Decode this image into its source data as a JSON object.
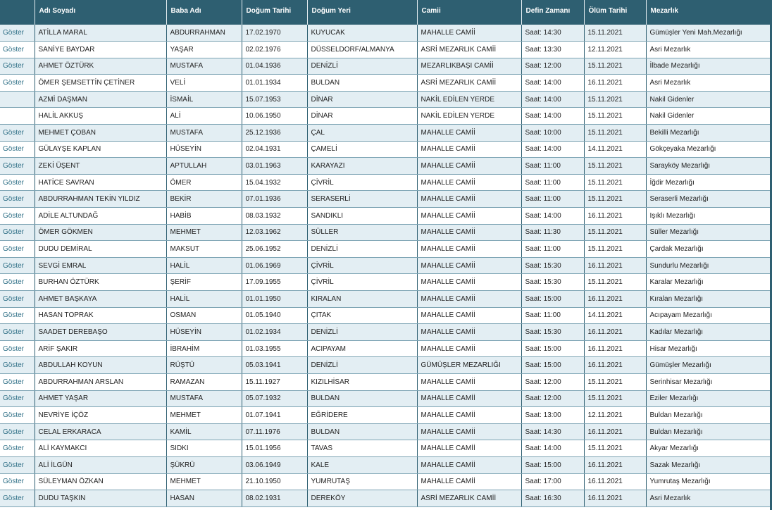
{
  "headers": [
    "",
    "Adı Soyadı",
    "Baba Adı",
    "Doğum Tarihi",
    "Doğum Yeri",
    "Camii",
    "Defin Zamanı",
    "Ölüm Tarihi",
    "Mezarlık"
  ],
  "show_label": "Göster",
  "rows": [
    {
      "show": true,
      "name": "ATİLLA MARAL",
      "father": "ABDURRAHMAN",
      "birth_date": "17.02.1970",
      "birth_place": "KUYUCAK",
      "mosque": "MAHALLE CAMİİ",
      "burial_time": "Saat: 14:30",
      "death_date": "15.11.2021",
      "cemetery": "Gümüşler Yeni Mah.Mezarlığı"
    },
    {
      "show": true,
      "name": "SANİYE BAYDAR",
      "father": "YAŞAR",
      "birth_date": "02.02.1976",
      "birth_place": "DÜSSELDORF/ALMANYA",
      "mosque": "ASRİ MEZARLIK CAMİİ",
      "burial_time": "Saat: 13:30",
      "death_date": "12.11.2021",
      "cemetery": "Asri Mezarlık"
    },
    {
      "show": true,
      "name": "AHMET ÖZTÜRK",
      "father": "MUSTAFA",
      "birth_date": "01.04.1936",
      "birth_place": "DENİZLİ",
      "mosque": "MEZARLIKBAŞI CAMİİ",
      "burial_time": "Saat: 12:00",
      "death_date": "15.11.2021",
      "cemetery": "İlbade Mezarlığı"
    },
    {
      "show": true,
      "name": "ÖMER ŞEMSETTİN ÇETİNER",
      "father": "VELİ",
      "birth_date": "01.01.1934",
      "birth_place": "BULDAN",
      "mosque": "ASRİ MEZARLIK CAMİİ",
      "burial_time": "Saat: 14:00",
      "death_date": "16.11.2021",
      "cemetery": "Asri Mezarlık"
    },
    {
      "show": false,
      "name": "AZMİ DAŞMAN",
      "father": "İSMAİL",
      "birth_date": "15.07.1953",
      "birth_place": "DİNAR",
      "mosque": "NAKİL EDİLEN YERDE",
      "burial_time": "Saat: 14:00",
      "death_date": "15.11.2021",
      "cemetery": "Nakil Gidenler"
    },
    {
      "show": false,
      "name": "HALİL AKKUŞ",
      "father": "ALİ",
      "birth_date": "10.06.1950",
      "birth_place": "DİNAR",
      "mosque": "NAKİL EDİLEN YERDE",
      "burial_time": "Saat: 14:00",
      "death_date": "15.11.2021",
      "cemetery": "Nakil Gidenler"
    },
    {
      "show": true,
      "name": "MEHMET ÇOBAN",
      "father": "MUSTAFA",
      "birth_date": "25.12.1936",
      "birth_place": "ÇAL",
      "mosque": "MAHALLE CAMİİ",
      "burial_time": "Saat: 10:00",
      "death_date": "15.11.2021",
      "cemetery": "Bekilli Mezarlığı"
    },
    {
      "show": true,
      "name": "GÜLAYŞE KAPLAN",
      "father": "HÜSEYİN",
      "birth_date": "02.04.1931",
      "birth_place": "ÇAMELİ",
      "mosque": "MAHALLE CAMİİ",
      "burial_time": "Saat: 14:00",
      "death_date": "14.11.2021",
      "cemetery": "Gökçeyaka Mezarlığı"
    },
    {
      "show": true,
      "name": "ZEKİ ÜŞENT",
      "father": "APTULLAH",
      "birth_date": "03.01.1963",
      "birth_place": "KARAYAZI",
      "mosque": "MAHALLE CAMİİ",
      "burial_time": "Saat: 11:00",
      "death_date": "15.11.2021",
      "cemetery": "Sarayköy Mezarlığı"
    },
    {
      "show": true,
      "name": "HATİCE SAVRAN",
      "father": "ÖMER",
      "birth_date": "15.04.1932",
      "birth_place": "ÇİVRİL",
      "mosque": "MAHALLE CAMİİ",
      "burial_time": "Saat: 11:00",
      "death_date": "15.11.2021",
      "cemetery": "İğdir Mezarlığı"
    },
    {
      "show": true,
      "name": "ABDURRAHMAN TEKİN YILDIZ",
      "father": "BEKİR",
      "birth_date": "07.01.1936",
      "birth_place": "SERASERLİ",
      "mosque": "MAHALLE CAMİİ",
      "burial_time": "Saat: 11:00",
      "death_date": "15.11.2021",
      "cemetery": "Seraserli Mezarlığı"
    },
    {
      "show": true,
      "name": "ADİLE ALTUNDAĞ",
      "father": "HABİB",
      "birth_date": "08.03.1932",
      "birth_place": "SANDIKLI",
      "mosque": "MAHALLE CAMİİ",
      "burial_time": "Saat: 14:00",
      "death_date": "16.11.2021",
      "cemetery": "Işıklı Mezarlığı"
    },
    {
      "show": true,
      "name": "ÖMER GÖKMEN",
      "father": "MEHMET",
      "birth_date": "12.03.1962",
      "birth_place": "SÜLLER",
      "mosque": "MAHALLE CAMİİ",
      "burial_time": "Saat: 11:30",
      "death_date": "15.11.2021",
      "cemetery": "Süller Mezarlığı"
    },
    {
      "show": true,
      "name": "DUDU DEMİRAL",
      "father": "MAKSUT",
      "birth_date": "25.06.1952",
      "birth_place": "DENİZLİ",
      "mosque": "MAHALLE CAMİİ",
      "burial_time": "Saat: 11:00",
      "death_date": "15.11.2021",
      "cemetery": "Çardak Mezarlığı"
    },
    {
      "show": true,
      "name": "SEVGİ EMRAL",
      "father": "HALİL",
      "birth_date": "01.06.1969",
      "birth_place": "ÇİVRİL",
      "mosque": "MAHALLE CAMİİ",
      "burial_time": "Saat: 15:30",
      "death_date": "16.11.2021",
      "cemetery": "Sundurlu Mezarlığı"
    },
    {
      "show": true,
      "name": "BURHAN ÖZTÜRK",
      "father": "ŞERİF",
      "birth_date": "17.09.1955",
      "birth_place": "ÇİVRİL",
      "mosque": "MAHALLE CAMİİ",
      "burial_time": "Saat: 15:30",
      "death_date": "15.11.2021",
      "cemetery": "Karalar Mezarlığı"
    },
    {
      "show": true,
      "name": "AHMET BAŞKAYA",
      "father": "HALİL",
      "birth_date": "01.01.1950",
      "birth_place": "KIRALAN",
      "mosque": "MAHALLE CAMİİ",
      "burial_time": "Saat: 15:00",
      "death_date": "16.11.2021",
      "cemetery": "Kıralan Mezarlığı"
    },
    {
      "show": true,
      "name": "HASAN TOPRAK",
      "father": "OSMAN",
      "birth_date": "01.05.1940",
      "birth_place": "ÇITAK",
      "mosque": "MAHALLE CAMİİ",
      "burial_time": "Saat: 11:00",
      "death_date": "14.11.2021",
      "cemetery": "Acıpayam Mezarlığı"
    },
    {
      "show": true,
      "name": "SAADET DEREBAŞO",
      "father": "HÜSEYİN",
      "birth_date": "01.02.1934",
      "birth_place": "DENİZLİ",
      "mosque": "MAHALLE CAMİİ",
      "burial_time": "Saat: 15:30",
      "death_date": "16.11.2021",
      "cemetery": "Kadılar Mezarlığı"
    },
    {
      "show": true,
      "name": "ARİF ŞAKIR",
      "father": "İBRAHİM",
      "birth_date": "01.03.1955",
      "birth_place": "ACIPAYAM",
      "mosque": "MAHALLE CAMİİ",
      "burial_time": "Saat: 15:00",
      "death_date": "16.11.2021",
      "cemetery": "Hisar Mezarlığı"
    },
    {
      "show": true,
      "name": "ABDULLAH KOYUN",
      "father": "RÜŞTÜ",
      "birth_date": "05.03.1941",
      "birth_place": "DENİZLİ",
      "mosque": "GÜMÜŞLER MEZARLIĞI",
      "burial_time": "Saat: 15:00",
      "death_date": "16.11.2021",
      "cemetery": "Gümüşler Mezarlığı"
    },
    {
      "show": true,
      "name": "ABDURRAHMAN ARSLAN",
      "father": "RAMAZAN",
      "birth_date": "15.11.1927",
      "birth_place": "KIZILHİSAR",
      "mosque": "MAHALLE CAMİİ",
      "burial_time": "Saat: 12:00",
      "death_date": "15.11.2021",
      "cemetery": "Serinhisar Mezarlığı"
    },
    {
      "show": true,
      "name": "AHMET YAŞAR",
      "father": "MUSTAFA",
      "birth_date": "05.07.1932",
      "birth_place": "BULDAN",
      "mosque": "MAHALLE CAMİİ",
      "burial_time": "Saat: 12:00",
      "death_date": "15.11.2021",
      "cemetery": "Eziler Mezarlığı"
    },
    {
      "show": true,
      "name": "NEVRİYE İÇÖZ",
      "father": "MEHMET",
      "birth_date": "01.07.1941",
      "birth_place": "EĞRİDERE",
      "mosque": "MAHALLE CAMİİ",
      "burial_time": "Saat: 13:00",
      "death_date": "12.11.2021",
      "cemetery": "Buldan Mezarlığı"
    },
    {
      "show": true,
      "name": "CELAL ERKARACA",
      "father": "KAMİL",
      "birth_date": "07.11.1976",
      "birth_place": "BULDAN",
      "mosque": "MAHALLE CAMİİ",
      "burial_time": "Saat: 14:30",
      "death_date": "16.11.2021",
      "cemetery": "Buldan Mezarlığı"
    },
    {
      "show": true,
      "name": "ALİ KAYMAKCI",
      "father": "SIDKI",
      "birth_date": "15.01.1956",
      "birth_place": "TAVAS",
      "mosque": "MAHALLE CAMİİ",
      "burial_time": "Saat: 14:00",
      "death_date": "15.11.2021",
      "cemetery": "Akyar Mezarlığı"
    },
    {
      "show": true,
      "name": "ALİ İLGÜN",
      "father": "ŞÜKRÜ",
      "birth_date": "03.06.1949",
      "birth_place": "KALE",
      "mosque": "MAHALLE CAMİİ",
      "burial_time": "Saat: 15:00",
      "death_date": "16.11.2021",
      "cemetery": "Sazak Mezarlığı"
    },
    {
      "show": true,
      "name": "SÜLEYMAN ÖZKAN",
      "father": "MEHMET",
      "birth_date": "21.10.1950",
      "birth_place": "YUMRUTAŞ",
      "mosque": "MAHALLE CAMİİ",
      "burial_time": "Saat: 17:00",
      "death_date": "16.11.2021",
      "cemetery": "Yumrutaş Mezarlığı"
    },
    {
      "show": true,
      "name": "DUDU TAŞKIN",
      "father": "HASAN",
      "birth_date": "08.02.1931",
      "birth_place": "DEREKÖY",
      "mosque": "ASRİ MEZARLIK CAMİİ",
      "burial_time": "Saat: 16:30",
      "death_date": "16.11.2021",
      "cemetery": "Asri Mezarlık"
    }
  ]
}
